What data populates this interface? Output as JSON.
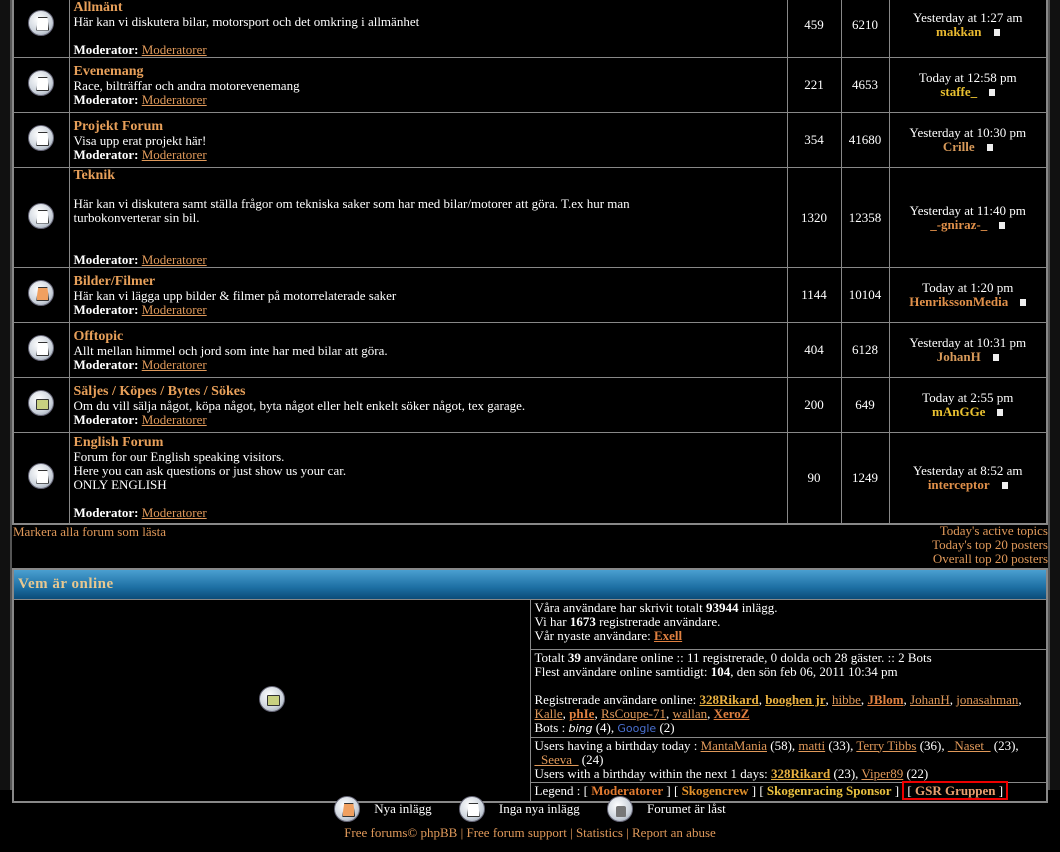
{
  "forums": [
    {
      "title": "Allmänt",
      "desc": [
        "Här kan vi diskutera bilar, motorsport och det omkring i allmänhet",
        ""
      ],
      "moderator_label": "Moderator:",
      "moderator": "Moderatorer",
      "topics": "459",
      "posts": "6210",
      "last_time": "Yesterday at 1:27 am",
      "last_user": "makkan",
      "user_color": "#e8b830",
      "icon": "no-new-posts-icon"
    },
    {
      "title": "Evenemang",
      "desc": [
        "Race, bilträffar och andra motorevenemang"
      ],
      "moderator_label": "Moderator:",
      "moderator": "Moderatorer",
      "topics": "221",
      "posts": "4653",
      "last_time": "Today at 12:58 pm",
      "last_user": "staffe_",
      "user_color": "#e8c030",
      "icon": "no-new-posts-icon"
    },
    {
      "title": "Projekt Forum",
      "desc": [
        "Visa upp erat projekt här!"
      ],
      "moderator_label": "Moderator:",
      "moderator": "Moderatorer",
      "topics": "354",
      "posts": "41680",
      "last_time": "Yesterday at 10:30 pm",
      "last_user": "Crille",
      "user_color": "#d89a5a",
      "icon": "no-new-posts-icon"
    },
    {
      "title": "Teknik",
      "desc": [
        "",
        "Här kan vi diskutera samt ställa frågor om tekniska saker som har med bilar/motorer att göra. T.ex hur man",
        "turbokonverterar sin bil.",
        "",
        ""
      ],
      "moderator_label": "Moderator:",
      "moderator": "Moderatorer",
      "topics": "1320",
      "posts": "12358",
      "last_time": "Yesterday at 11:40 pm",
      "last_user": "_-gniraz-_",
      "user_color": "#e0904a",
      "icon": "no-new-posts-icon"
    },
    {
      "title": "Bilder/Filmer",
      "desc": [
        "Här kan vi lägga upp bilder & filmer på motorrelaterade saker"
      ],
      "moderator_label": "Moderator:",
      "moderator": "Moderatorer",
      "topics": "1144",
      "posts": "10104",
      "last_time": "Today at 1:20 pm",
      "last_user": "HenrikssonMedia",
      "user_color": "#e0904a",
      "icon": "new-posts-icon"
    },
    {
      "title": "Offtopic",
      "desc": [
        "Allt mellan himmel och jord som inte har med bilar att göra."
      ],
      "moderator_label": "Moderator:",
      "moderator": "Moderatorer",
      "topics": "404",
      "posts": "6128",
      "last_time": "Yesterday at 10:31 pm",
      "last_user": "JohanH",
      "user_color": "#d89a5a",
      "icon": "no-new-posts-icon"
    },
    {
      "title": "Säljes / Köpes / Bytes / Sökes",
      "desc": [
        "Om du vill sälja något, köpa något, byta något eller helt enkelt söker något, tex garage."
      ],
      "moderator_label": "Moderator:",
      "moderator": "Moderatorer",
      "topics": "200",
      "posts": "649",
      "last_time": "Today at 2:55 pm",
      "last_user": "mAnGGe",
      "user_color": "#e8c030",
      "icon": "folder-icon"
    },
    {
      "title": "English Forum",
      "desc": [
        "Forum for our English speaking visitors.",
        "Here you can ask questions or just show us your car.",
        "ONLY ENGLISH",
        ""
      ],
      "moderator_label": "Moderator:",
      "moderator": "Moderatorer",
      "topics": "90",
      "posts": "1249",
      "last_time": "Yesterday at 8:52 am",
      "last_user": "interceptor",
      "user_color": "#e0904a",
      "icon": "no-new-posts-icon"
    }
  ],
  "mark_read": "Markera alla forum som lästa",
  "right_links": [
    "Today's active topics",
    "Today's top 20 posters",
    "Overall top 20 posters"
  ],
  "online": {
    "title": "Vem är online",
    "stats": {
      "l1a": "Våra användare har skrivit totalt ",
      "posts": "93944",
      "l1b": " inlägg.",
      "l2a": "Vi har ",
      "users": "1673",
      "l2b": " registrerade användare.",
      "l3": "Vår nyaste användare: ",
      "newest": "Exell"
    },
    "now": {
      "l1a": "Totalt ",
      "total": "39",
      "l1b": " användare online :: 11 registrerade, 0 dolda och 28 gäster. :: 2 Bots",
      "l2a": "Flest användare online samtidigt: ",
      "max": "104",
      "l2b": ", den sön feb 06, 2011 10:34 pm",
      "reg_label": "Registrerade användare online: ",
      "users": [
        {
          "n": "328Rikard",
          "s": "ub"
        },
        {
          "n": "booghen jr",
          "s": "ub"
        },
        {
          "n": "hibbe",
          "s": "u"
        },
        {
          "n": "JBlom",
          "s": "uo"
        },
        {
          "n": "JohanH",
          "s": "u"
        },
        {
          "n": "jonasahman",
          "s": "u"
        },
        {
          "n": "Kalle",
          "s": "u"
        },
        {
          "n": "phIe",
          "s": "uo"
        },
        {
          "n": "RsCoupe-71",
          "s": "u"
        },
        {
          "n": "wallan",
          "s": "u"
        },
        {
          "n": "XeroZ",
          "s": "uo"
        }
      ],
      "bots_label": "Bots : ",
      "bot1": "bing",
      "bot1_count": " (4), ",
      "bot2": "Google",
      "bot2_count": " (2)"
    },
    "birthday": {
      "today_label": "Users having a birthday today : ",
      "today": [
        {
          "n": "MantaMania",
          "a": "(58)"
        },
        {
          "n": "matti",
          "a": "(33)"
        },
        {
          "n": "Terry Tibbs",
          "a": "(36)"
        },
        {
          "n": "_Naset_",
          "a": "(23)"
        },
        {
          "n": "_Seeva_",
          "a": "(24)"
        }
      ],
      "next_label": "Users with a birthday within the next 1 days: ",
      "next": [
        {
          "n": "328Rikard",
          "a": "(23)",
          "s": "ub"
        },
        {
          "n": "Viper89",
          "a": "(22)",
          "s": "u"
        }
      ]
    },
    "legend": {
      "label": "Legend : ",
      "groups": [
        "Moderatorer",
        "Skogencrew",
        "Skogenracing Sponsor",
        "GSR Gruppen"
      ]
    }
  },
  "footer": {
    "new_posts": "Nya inlägg",
    "no_new_posts": "Inga nya inlägg",
    "locked": "Forumet är låst",
    "links": [
      "Free forums© phpBB",
      "Free forum support",
      "Statistics",
      "Report an abuse"
    ]
  }
}
